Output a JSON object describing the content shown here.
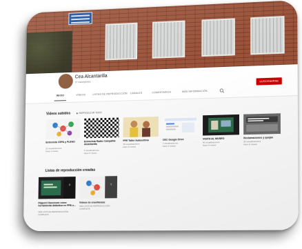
{
  "channel": {
    "name": "Cea Alcantarilla",
    "subscribers": "37 suscriptores",
    "subscribe_label": "SUSCRIBIRSE"
  },
  "banner": {
    "sign_text": "Centro de Educación de Personas Adultas · Alcantarilla"
  },
  "tabs": [
    "INICIO",
    "VÍDEOS",
    "LISTAS DE REPRODUCCIÓN",
    "CANALES",
    "COMENTARIOS",
    "MÁS INFORMACIÓN"
  ],
  "search_icon": "search-icon",
  "uploads": {
    "title": "Videos subidos",
    "play_all": "REPRODUCIR TODO",
    "items": [
      {
        "title": "Entrevista CEPA y PLENO",
        "views": "22 visualizaciones",
        "age": "Hace 4 meses"
      },
      {
        "title": "Entrevista Radio Compañía Alcantarilla",
        "views": "9 visualizaciones",
        "age": "Hace 5 meses"
      },
      {
        "title": "PFE Taller Autoestima",
        "views": "38 visualizaciones",
        "age": "Hace 6 meses"
      },
      {
        "title": "CEC Google Drive",
        "views": "7 visualizaciones",
        "age": "Hace 6 meses"
      },
      {
        "title": "VISITA AL MUSEO",
        "views": "40 visualizaciones",
        "age": "Hace 6 meses"
      },
      {
        "title": "Reclamaciones y quejas",
        "views": "26 visualizaciones",
        "age": "Hace 6 meses"
      }
    ]
  },
  "playlists": {
    "title": "Listas de reproducción creadas",
    "items": [
      {
        "title": "Flipped Classroom como herramienta didáctica en FPB o...",
        "meta": "VER LISTA DE REPRODUCCIÓN COMPLETA",
        "count": "3"
      },
      {
        "title": "Vídeos de enseñanzas",
        "meta": "VER LISTA DE REPRODUCCIÓN COMPLETA",
        "count": "1"
      }
    ]
  },
  "colors": {
    "subscribe": "#cc0000",
    "brick": "#9a5239"
  }
}
